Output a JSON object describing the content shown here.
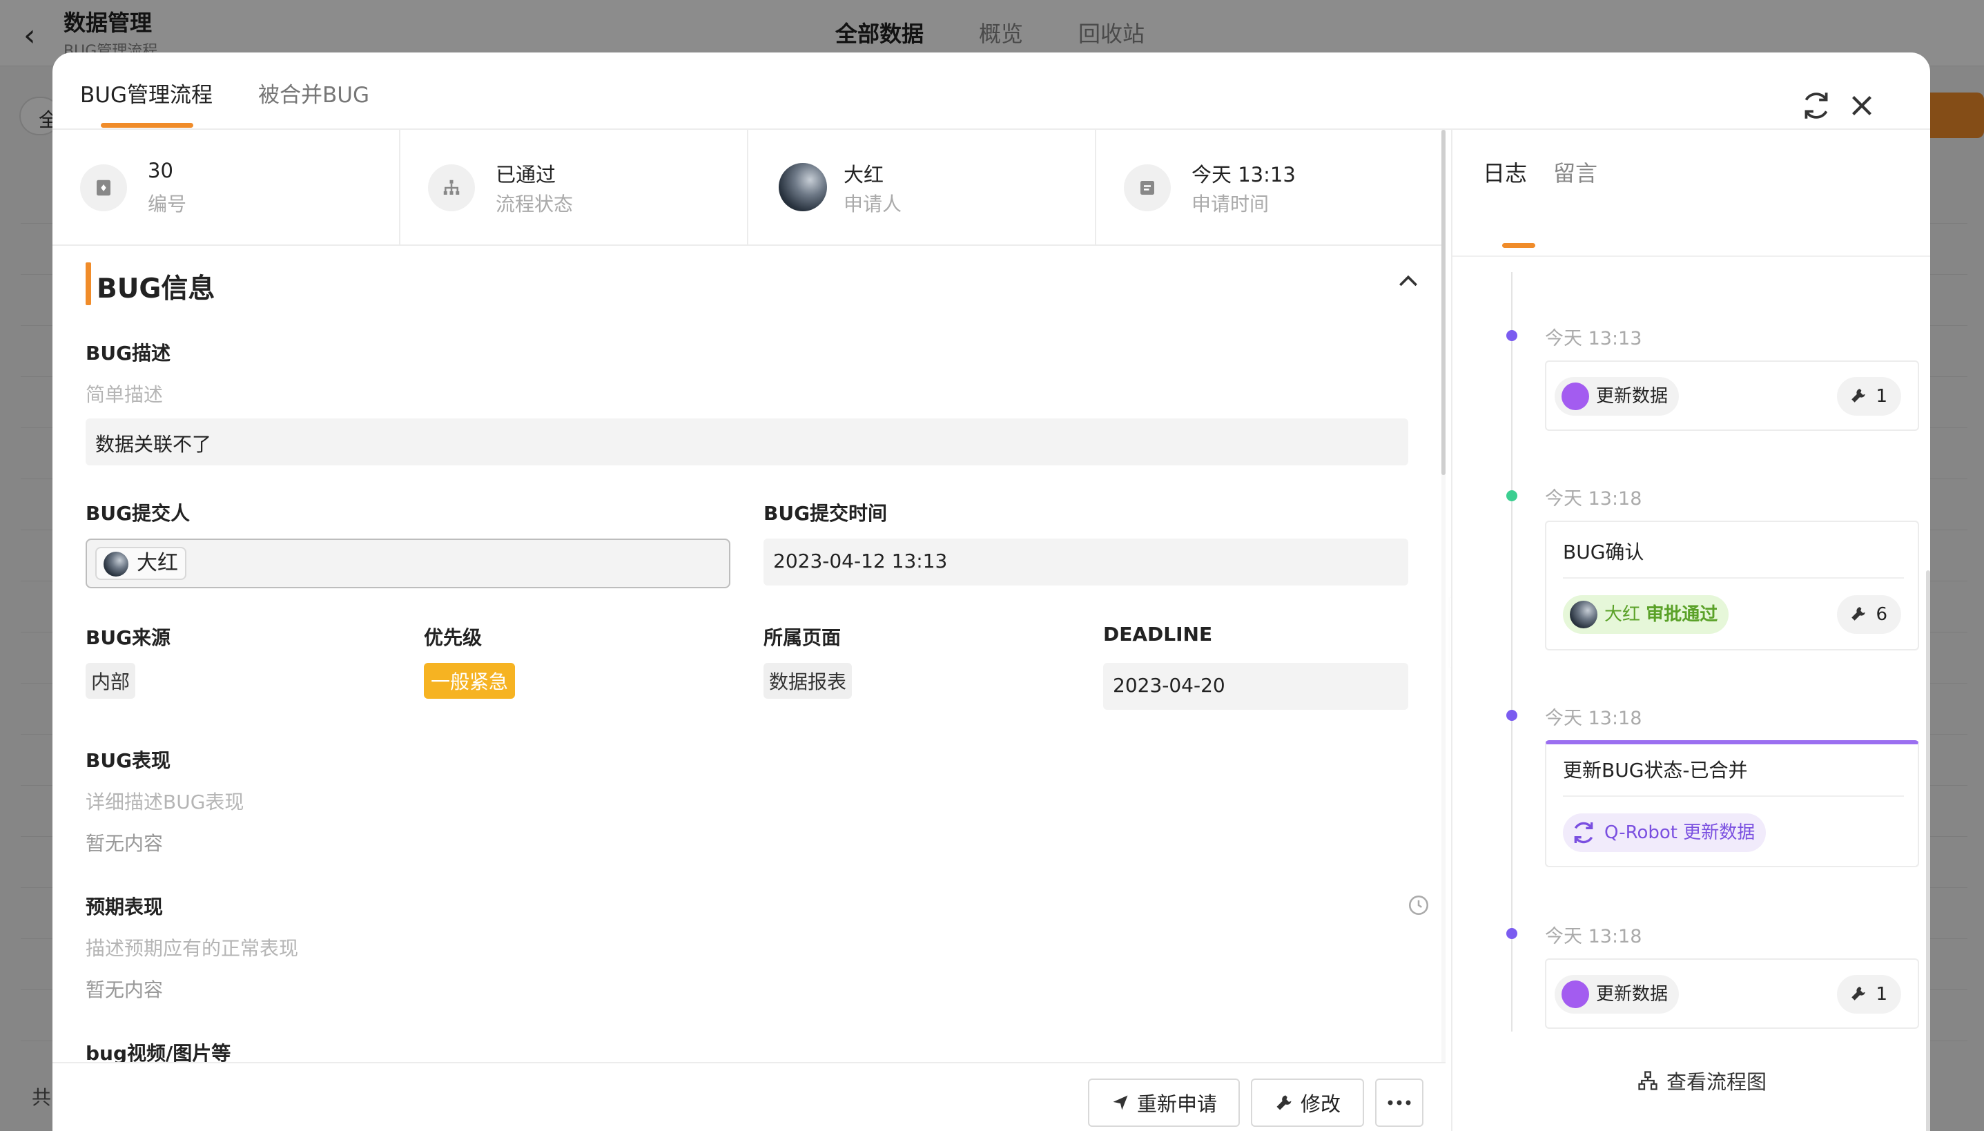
{
  "background": {
    "title": "数据管理",
    "subtitle": "BUG管理流程",
    "tabs": [
      "全部数据",
      "概览",
      "回收站"
    ],
    "left_button": "全",
    "footer_text": "共"
  },
  "modal": {
    "tabs": [
      "BUG管理流程",
      "被合并BUG"
    ],
    "info": {
      "number": {
        "value": "30",
        "label": "编号",
        "icon": "id-icon"
      },
      "status": {
        "value": "已通过",
        "label": "流程状态",
        "icon": "flow-icon"
      },
      "applicant": {
        "value": "大红",
        "label": "申请人"
      },
      "time": {
        "value": "今天 13:13",
        "label": "申请时间",
        "icon": "calendar-icon"
      }
    },
    "section_title": "BUG信息",
    "fields": {
      "desc": {
        "label": "BUG描述",
        "hint": "简单描述",
        "value": "数据关联不了"
      },
      "submitter": {
        "label": "BUG提交人",
        "value": "大红"
      },
      "submit_time": {
        "label": "BUG提交时间",
        "value": "2023-04-12 13:13"
      },
      "source": {
        "label": "BUG来源",
        "value": "内部"
      },
      "priority": {
        "label": "优先级",
        "value": "一般紧急",
        "color": "#f6b322"
      },
      "page": {
        "label": "所属页面",
        "value": "数据报表"
      },
      "deadline": {
        "label": "DEADLINE",
        "value": "2023-04-20"
      },
      "behavior": {
        "label": "BUG表现",
        "hint": "详细描述BUG表现",
        "empty": "暂无内容"
      },
      "expected": {
        "label": "预期表现",
        "hint": "描述预期应有的正常表现",
        "empty": "暂无内容"
      },
      "media": {
        "label": "bug视频/图片等"
      }
    },
    "actions": {
      "reapply": "重新申请",
      "edit": "修改"
    }
  },
  "log_panel": {
    "tabs": [
      "日志",
      "留言"
    ],
    "entries": [
      {
        "time": "今天 13:13",
        "dot_color": "#7b5cf0",
        "chip": "更新数据",
        "count": "1"
      },
      {
        "time": "今天 13:18",
        "dot_color": "#3ccf91",
        "title": "BUG确认",
        "chip_user": "大红",
        "chip_action": "审批通过",
        "count": "6"
      },
      {
        "time": "今天 13:18",
        "dot_color": "#7b5cf0",
        "title": "更新BUG状态-已合并",
        "chip": "Q-Robot 更新数据",
        "accent": "#9b6ff0"
      },
      {
        "time": "今天 13:18",
        "dot_color": "#7b5cf0",
        "chip": "更新数据",
        "count": "1"
      }
    ],
    "flow_link": "查看流程图"
  },
  "colors": {
    "accent": "#f08c2a",
    "success": "#5aa128",
    "purple": "#7a4fe0"
  }
}
